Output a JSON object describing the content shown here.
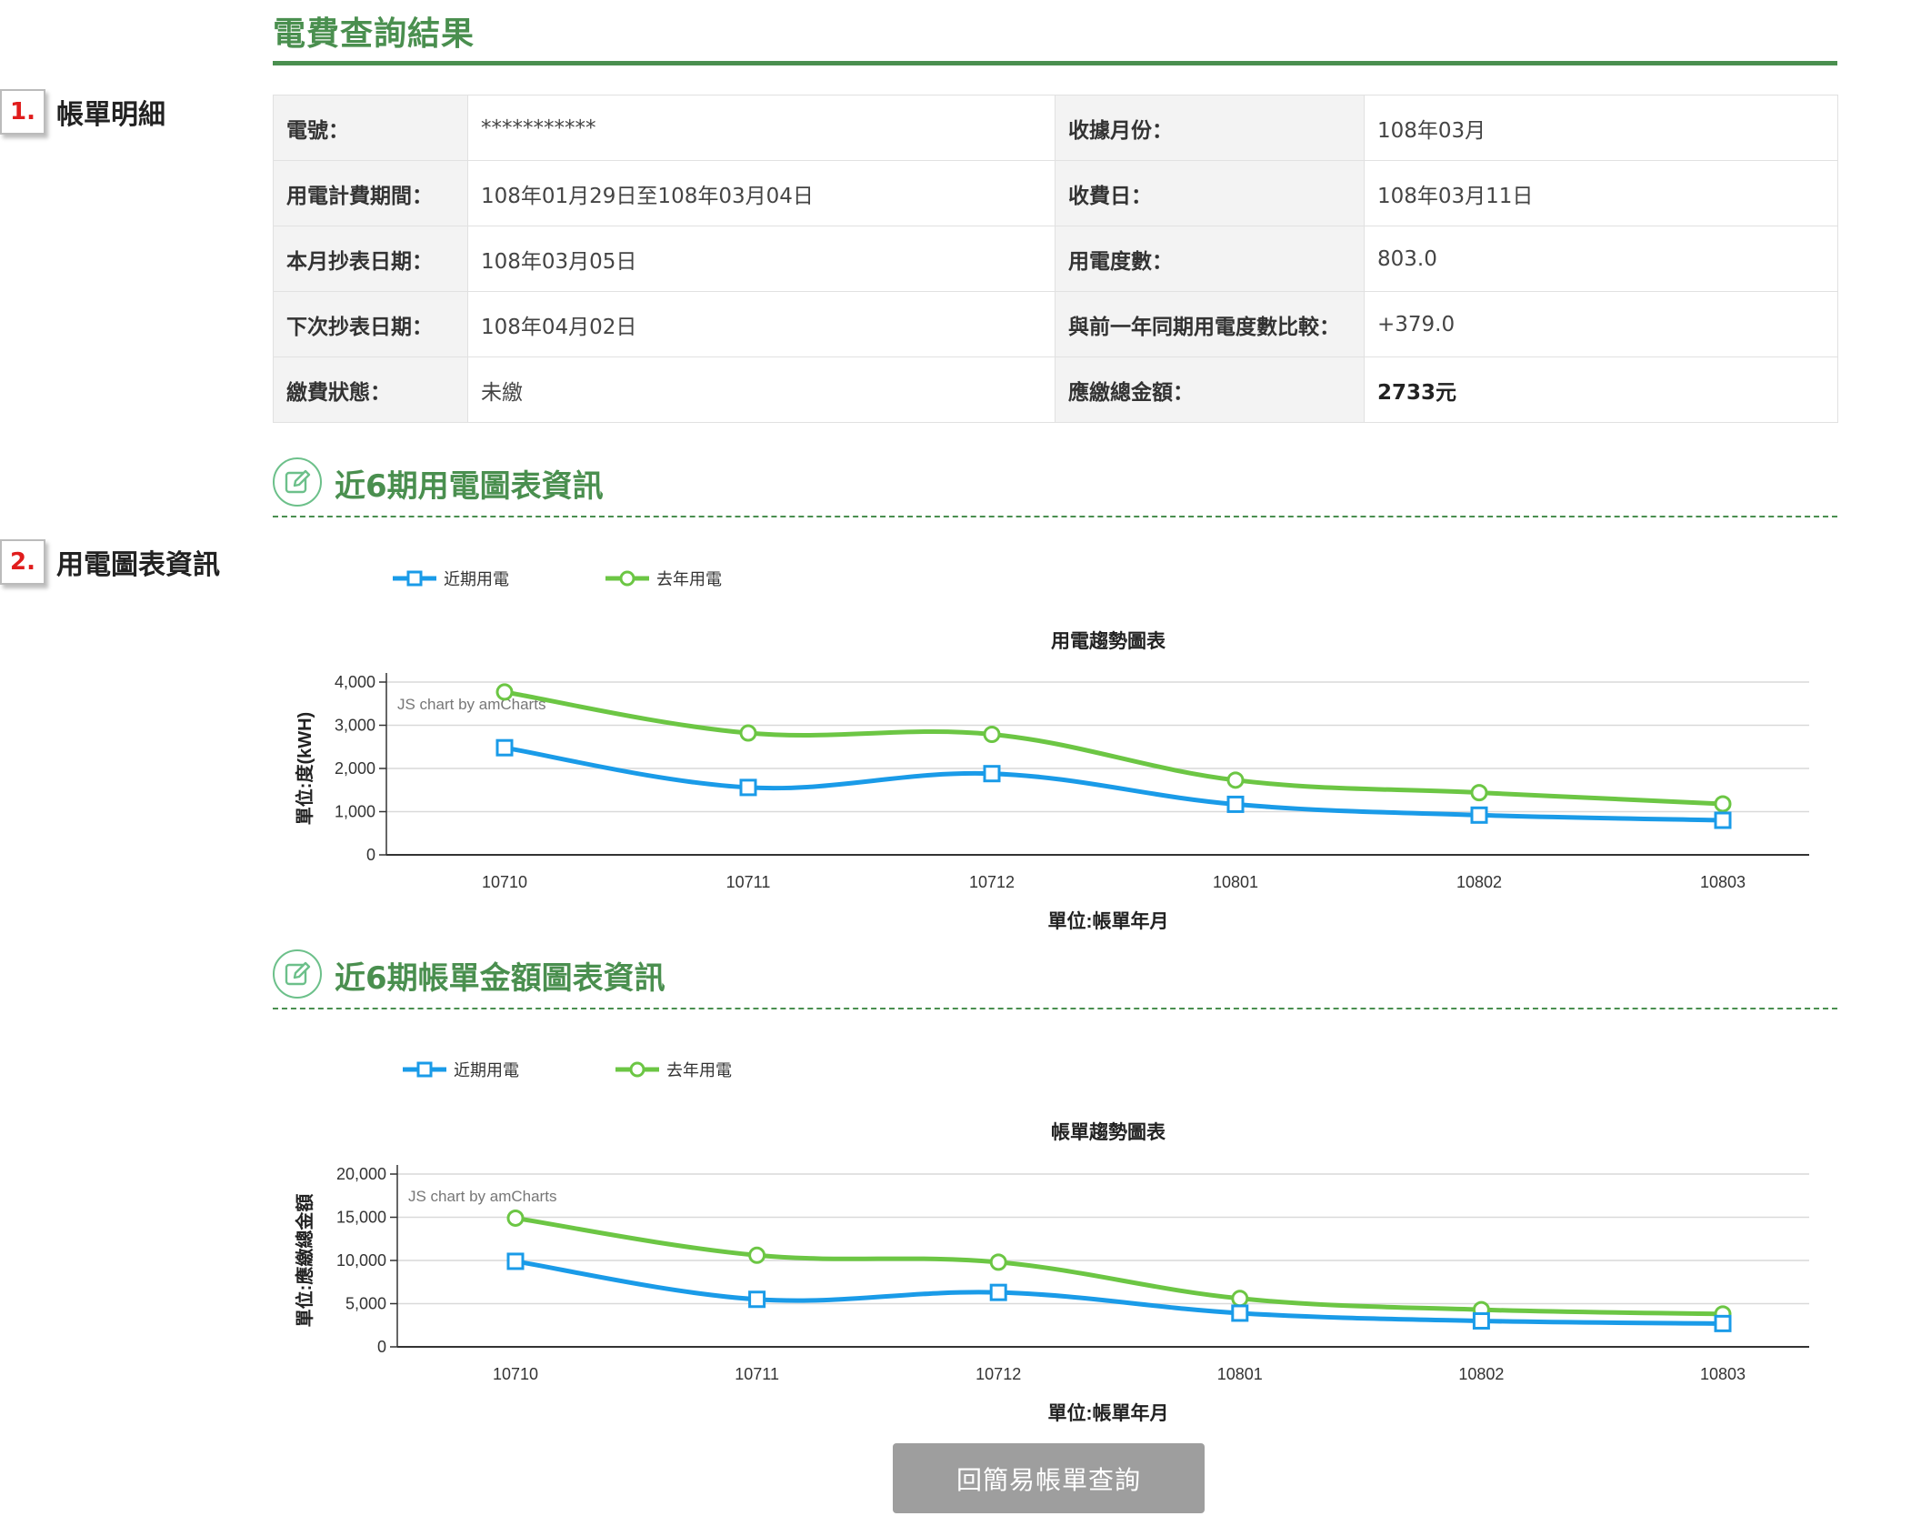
{
  "page": {
    "title": "電費查詢結果"
  },
  "steps": [
    {
      "num": "1.",
      "label": "帳單明細"
    },
    {
      "num": "2.",
      "label": "用電圖表資訊"
    }
  ],
  "bill": {
    "rows": [
      {
        "l1": "電號：",
        "v1": "***********",
        "l2": "收據月份：",
        "v2": "108年03月"
      },
      {
        "l1": "用電計費期間：",
        "v1": "108年01月29日至108年03月04日",
        "l2": "收費日：",
        "v2": "108年03月11日"
      },
      {
        "l1": "本月抄表日期：",
        "v1": "108年03月05日",
        "l2": "用電度數：",
        "v2": "803.0"
      },
      {
        "l1": "下次抄表日期：",
        "v1": "108年04月02日",
        "l2": "與前一年同期用電度數比較：",
        "v2": "+379.0"
      },
      {
        "l1": "繳費狀態：",
        "v1": "未繳",
        "l2": "應繳總金額：",
        "v2": "2733元"
      }
    ]
  },
  "sections": {
    "usage": {
      "title": "近6期用電圖表資訊",
      "icon": "edit-icon"
    },
    "amount": {
      "title": "近6期帳單金額圖表資訊",
      "icon": "edit-icon"
    }
  },
  "colors": {
    "recent": "#1a9be8",
    "last_year": "#6cc644",
    "brand_green": "#4a8f4f"
  },
  "chart_data": [
    {
      "type": "line",
      "title": "用電趨勢圖表",
      "xlabel": "單位:帳單年月",
      "ylabel": "單位:度(kWH)",
      "credit": "JS chart by amCharts",
      "legend_position": "top-left",
      "ylim": [
        0,
        4000
      ],
      "yticks": [
        "4,000",
        "3,000",
        "2,000",
        "1,000",
        "0"
      ],
      "categories": [
        "10710",
        "10711",
        "10712",
        "10801",
        "10802",
        "10803"
      ],
      "series": [
        {
          "name": "近期用電",
          "values": [
            2480,
            1560,
            1880,
            1170,
            920,
            800
          ],
          "marker": "square"
        },
        {
          "name": "去年用電",
          "values": [
            3770,
            2820,
            2790,
            1730,
            1440,
            1180
          ],
          "marker": "circle"
        }
      ]
    },
    {
      "type": "line",
      "title": "帳單趨勢圖表",
      "xlabel": "單位:帳單年月",
      "ylabel": "單位:應繳總金額",
      "credit": "JS chart by amCharts",
      "legend_position": "top-left",
      "ylim": [
        0,
        20000
      ],
      "yticks": [
        "20,000",
        "15,000",
        "10,000",
        "5,000",
        "0"
      ],
      "categories": [
        "10710",
        "10711",
        "10712",
        "10801",
        "10802",
        "10803"
      ],
      "series": [
        {
          "name": "近期用電",
          "values": [
            9900,
            5500,
            6300,
            3900,
            3000,
            2700
          ],
          "marker": "square"
        },
        {
          "name": "去年用電",
          "values": [
            14900,
            10600,
            9800,
            5600,
            4300,
            3800
          ],
          "marker": "circle"
        }
      ]
    }
  ],
  "button": {
    "label": "回簡易帳單查詢"
  }
}
